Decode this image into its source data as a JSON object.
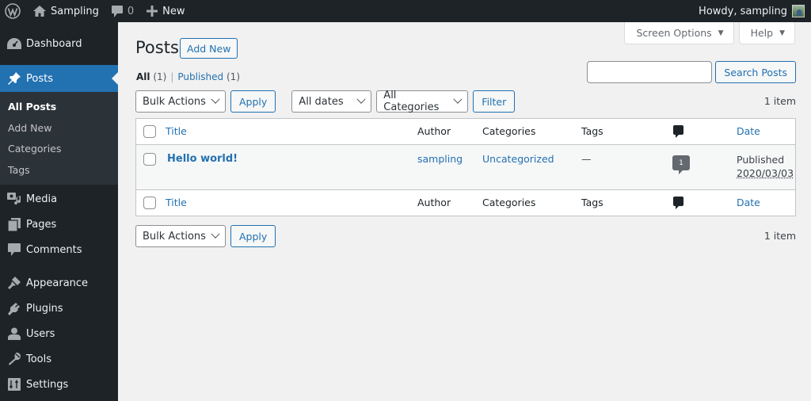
{
  "adminbar": {
    "site_name": "Sampling",
    "comments_count": "0",
    "new_label": "New",
    "greeting": "Howdy, sampling"
  },
  "sidebar": {
    "items": [
      {
        "label": "Dashboard",
        "icon": "dashboard-icon"
      },
      {
        "label": "Posts",
        "icon": "pin-icon",
        "active": true
      },
      {
        "label": "Media",
        "icon": "media-icon"
      },
      {
        "label": "Pages",
        "icon": "pages-icon"
      },
      {
        "label": "Comments",
        "icon": "comment-icon"
      },
      {
        "label": "Appearance",
        "icon": "paintbrush-icon"
      },
      {
        "label": "Plugins",
        "icon": "plugin-icon"
      },
      {
        "label": "Users",
        "icon": "user-icon"
      },
      {
        "label": "Tools",
        "icon": "wrench-icon"
      },
      {
        "label": "Settings",
        "icon": "settings-icon"
      }
    ],
    "submenu": [
      "All Posts",
      "Add New",
      "Categories",
      "Tags"
    ]
  },
  "screen_meta": {
    "screen_options": "Screen Options",
    "help": "Help"
  },
  "page": {
    "title": "Posts",
    "add_new": "Add New"
  },
  "views": {
    "all_label": "All",
    "all_count": "(1)",
    "published_label": "Published",
    "published_count": "(1)"
  },
  "search": {
    "value": "",
    "button": "Search Posts"
  },
  "tablenav_top": {
    "bulk_actions": "Bulk Actions",
    "apply": "Apply",
    "dates": "All dates",
    "categories": "All Categories",
    "filter": "Filter",
    "count": "1 item"
  },
  "tablenav_bottom": {
    "bulk_actions": "Bulk Actions",
    "apply": "Apply",
    "count": "1 item"
  },
  "table": {
    "columns": {
      "title": "Title",
      "author": "Author",
      "categories": "Categories",
      "tags": "Tags",
      "date": "Date"
    },
    "rows": [
      {
        "title": "Hello world!",
        "author": "sampling",
        "categories": "Uncategorized",
        "tags": "—",
        "comments": "1",
        "status": "Published",
        "date": "2020/03/03"
      }
    ]
  },
  "colors": {
    "accent": "#2271b1",
    "adminbar_bg": "#1d2327",
    "submenu_bg": "#2c3338",
    "page_bg": "#f1f1f1"
  }
}
